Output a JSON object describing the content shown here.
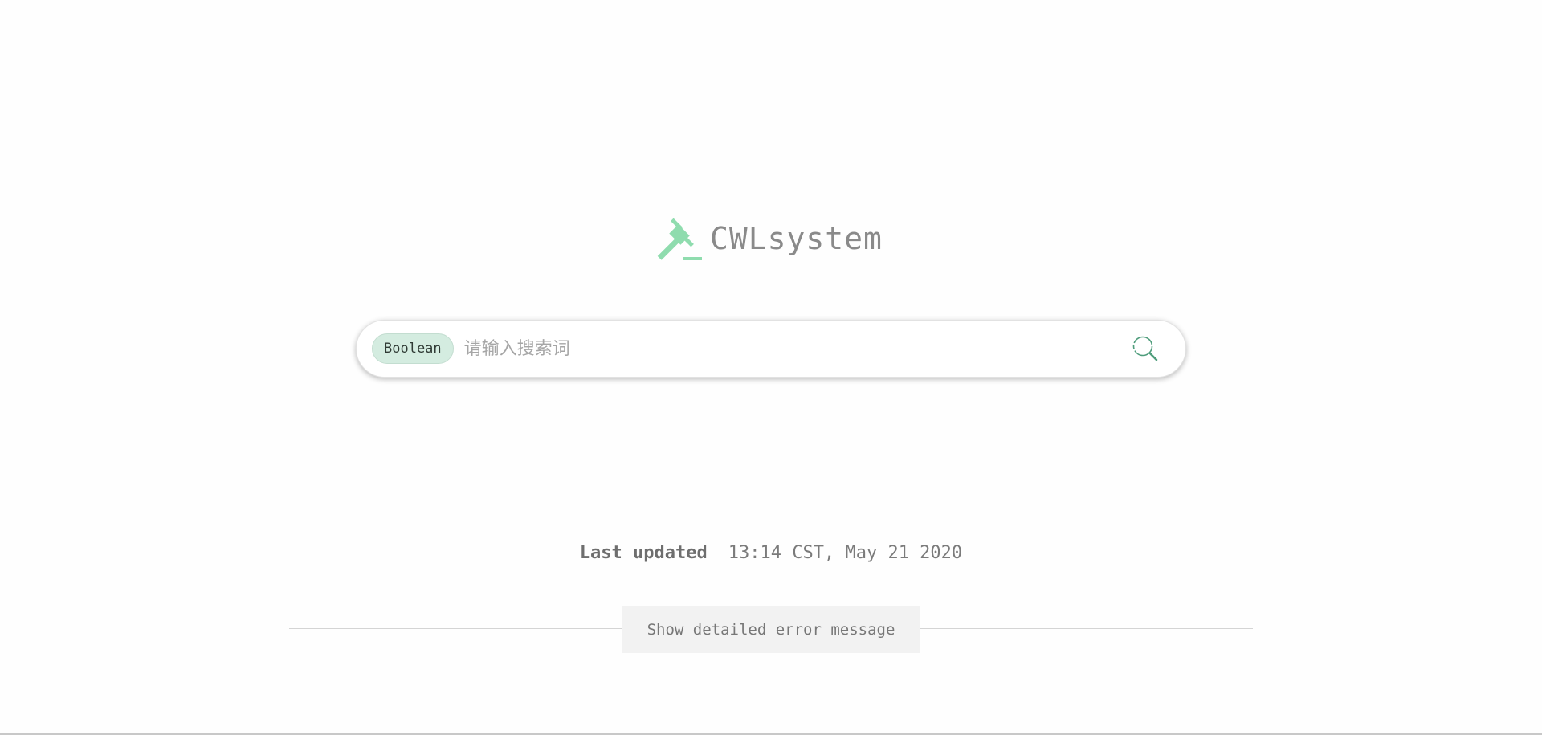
{
  "brand": {
    "name": "CWLsystem",
    "logo_icon": "gavel-icon",
    "logo_color": "#8fdcae"
  },
  "search": {
    "mode_label": "Boolean",
    "placeholder": "请输入搜索词",
    "value": "",
    "submit_icon": "search-icon",
    "accent": "#4f9d7c"
  },
  "status": {
    "last_updated_label": "Last updated",
    "last_updated_value": "13:14 CST, May 21 2020"
  },
  "error": {
    "toggle_label": "Show detailed error message"
  }
}
